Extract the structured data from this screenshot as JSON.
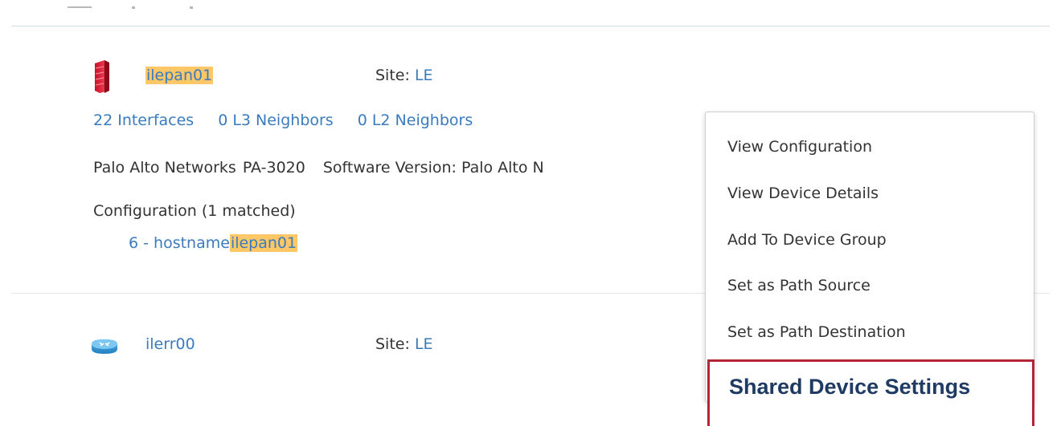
{
  "device1": {
    "name_highlight": "ilepan01",
    "site_label": "Site:",
    "site_value": "LE",
    "interfaces": "22 Interfaces",
    "l3_neighbors": "0 L3 Neighbors",
    "l2_neighbors": "0 L2 Neighbors",
    "vendor": "Palo Alto Networks",
    "model": "PA-3020",
    "software": "Software Version: Palo Alto N",
    "config_heading": "Configuration (1 matched)",
    "config_line_number": "6 -",
    "config_line_text": "hostname",
    "config_line_highlight": "ilepan01"
  },
  "device2": {
    "name": "ilerr00",
    "site_label": "Site:",
    "site_value": "LE"
  },
  "context_menu": {
    "items": [
      "View Configuration",
      "View Device Details",
      "Add To Device Group",
      "Set as Path Source",
      "Set as Path Destination"
    ],
    "highlighted_item": "Shared Device Settings"
  },
  "colors": {
    "link": "#3a7bbf",
    "highlight": "#ffc766",
    "callout_border": "#b32636",
    "callout_text": "#1f3b63"
  }
}
